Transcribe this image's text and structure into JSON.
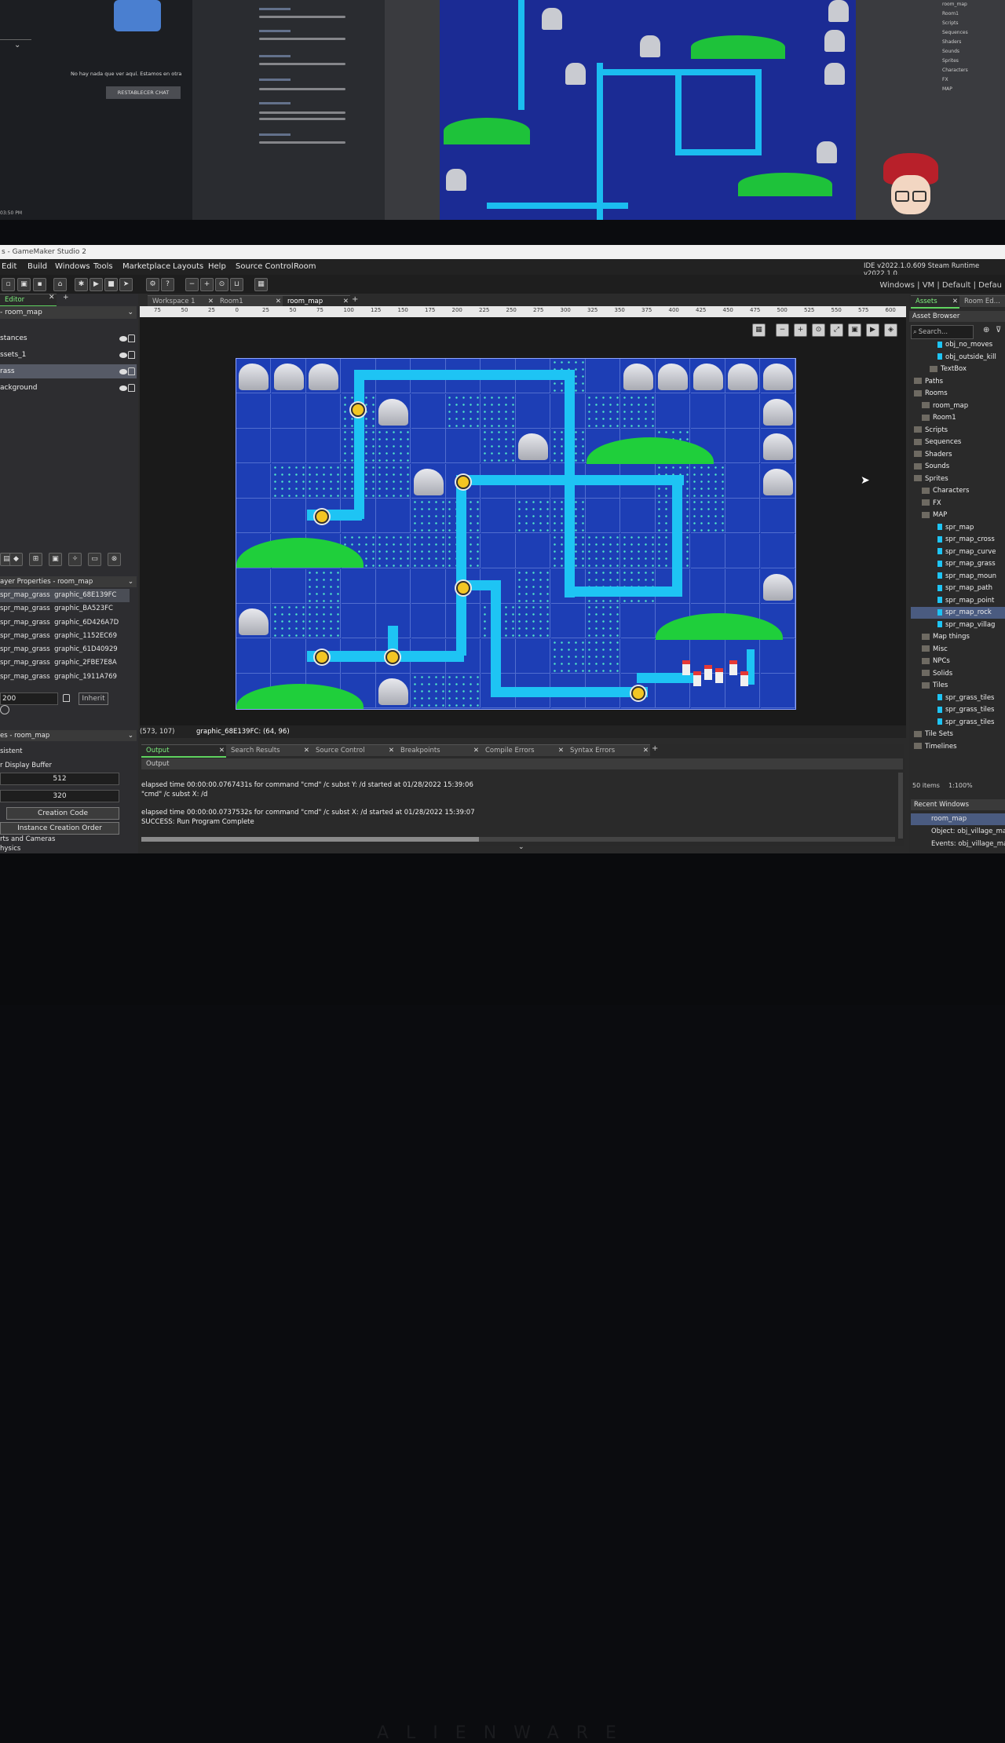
{
  "background": {
    "chat": {
      "empty_message": "No hay nada que ver aquí. Estamos en otra",
      "reset_button": "RESTABLECER CHAT",
      "time": "03:50 PM"
    },
    "right_tree": [
      "room_map",
      "Room1",
      "Scripts",
      "Sequences",
      "Shaders",
      "Sounds",
      "Sprites",
      "Characters",
      "FX",
      "MAP"
    ]
  },
  "window": {
    "title": "s - GameMaker Studio 2",
    "version": "IDE v2022.1.0.609 Steam  Runtime v2022.1.0."
  },
  "menu": [
    "Edit",
    "Build",
    "Windows",
    "Tools",
    "Marketplace",
    "Layouts",
    "Help",
    "Source Control",
    "Room"
  ],
  "layout_links": "Windows  |  VM  |  Default  |  Defau",
  "left_panel": {
    "tab": "Editor",
    "room_dropdown": "- room_map",
    "layers": [
      "stances",
      "ssets_1",
      "rass",
      "ackground"
    ],
    "layer_props_title": "ayer Properties - room_map",
    "tiles": [
      {
        "sprite": "spr_map_grass",
        "graphic": "graphic_68E139FC"
      },
      {
        "sprite": "spr_map_grass",
        "graphic": "graphic_BA523FC"
      },
      {
        "sprite": "spr_map_grass",
        "graphic": "graphic_6D426A7D"
      },
      {
        "sprite": "spr_map_grass",
        "graphic": "graphic_1152EC69"
      },
      {
        "sprite": "spr_map_grass",
        "graphic": "graphic_61D40929"
      },
      {
        "sprite": "spr_map_grass",
        "graphic": "graphic_2FBE7E8A"
      },
      {
        "sprite": "spr_map_grass",
        "graphic": "graphic_1911A769"
      }
    ],
    "depth_value": "200",
    "inherit_label": "Inherit",
    "room_props_title": "es - room_map",
    "persistent": "sistent",
    "display_buffer": "r Display Buffer",
    "width": "512",
    "height": "320",
    "creation_code": "Creation Code",
    "instance_order": "Instance Creation Order",
    "viewports": "rts and Cameras",
    "physics": "hysics"
  },
  "tabs": [
    "Workspace 1",
    "Room1",
    "room_map"
  ],
  "ruler_ticks": [
    "75",
    "50",
    "25",
    "0",
    "25",
    "50",
    "75",
    "100",
    "125",
    "150",
    "175",
    "200",
    "225",
    "250",
    "275",
    "300",
    "325",
    "350",
    "375",
    "400",
    "425",
    "450",
    "475",
    "500",
    "525",
    "550",
    "575",
    "600"
  ],
  "status": {
    "coords": "(573, 107)",
    "tile_info": "graphic_68E139FC: (64, 96)"
  },
  "output": {
    "tabs": [
      "Output",
      "Search Results",
      "Source Control",
      "Breakpoints",
      "Compile Errors",
      "Syntax Errors"
    ],
    "subheader": "Output",
    "lines": [
      "elapsed time 00:00:00.0767431s for command \"cmd\" /c subst Y: /d started at 01/28/2022 15:39:06",
      "\"cmd\"  /c subst X: /d",
      "",
      "elapsed time 00:00:00.0737532s for command \"cmd\" /c subst X: /d started at 01/28/2022 15:39:07",
      "SUCCESS: Run Program Complete"
    ]
  },
  "assets": {
    "tabs": [
      "Assets",
      "Room Ed..."
    ],
    "title": "Asset Browser",
    "search_placeholder": "Search...",
    "tree": [
      {
        "label": "obj_no_moves",
        "indent": 3
      },
      {
        "label": "obj_outside_kill",
        "indent": 3
      },
      {
        "label": "TextBox",
        "indent": 2
      },
      {
        "label": "Paths",
        "indent": 0
      },
      {
        "label": "Rooms",
        "indent": 0
      },
      {
        "label": "room_map",
        "indent": 1
      },
      {
        "label": "Room1",
        "indent": 1
      },
      {
        "label": "Scripts",
        "indent": 0
      },
      {
        "label": "Sequences",
        "indent": 0
      },
      {
        "label": "Shaders",
        "indent": 0
      },
      {
        "label": "Sounds",
        "indent": 0
      },
      {
        "label": "Sprites",
        "indent": 0
      },
      {
        "label": "Characters",
        "indent": 1
      },
      {
        "label": "FX",
        "indent": 1
      },
      {
        "label": "MAP",
        "indent": 1
      },
      {
        "label": "spr_map",
        "indent": 3
      },
      {
        "label": "spr_map_cross",
        "indent": 3
      },
      {
        "label": "spr_map_curve",
        "indent": 3
      },
      {
        "label": "spr_map_grass",
        "indent": 3
      },
      {
        "label": "spr_map_moun",
        "indent": 3
      },
      {
        "label": "spr_map_path",
        "indent": 3
      },
      {
        "label": "spr_map_point",
        "indent": 3
      },
      {
        "label": "spr_map_rock",
        "indent": 3
      },
      {
        "label": "spr_map_villag",
        "indent": 3
      },
      {
        "label": "Map things",
        "indent": 1
      },
      {
        "label": "Misc",
        "indent": 1
      },
      {
        "label": "NPCs",
        "indent": 1
      },
      {
        "label": "Solids",
        "indent": 1
      },
      {
        "label": "Tiles",
        "indent": 1
      },
      {
        "label": "spr_grass_tiles",
        "indent": 3
      },
      {
        "label": "spr_grass_tiles",
        "indent": 3
      },
      {
        "label": "spr_grass_tiles",
        "indent": 3
      },
      {
        "label": "Tile Sets",
        "indent": 0
      },
      {
        "label": "Timelines",
        "indent": 0
      }
    ],
    "count": "50 items",
    "zoom": "1:100%",
    "recent_title": "Recent Windows",
    "recent": [
      "room_map",
      "Object: obj_village_map",
      "Events: obj_village_map"
    ]
  },
  "brand": "ALIENWARE",
  "colors": {
    "accent": "#5fd35f",
    "map_bg": "#1d3eb5",
    "path": "#1ec4f4",
    "hill": "#1fcf3b",
    "node": "#f3c623"
  }
}
